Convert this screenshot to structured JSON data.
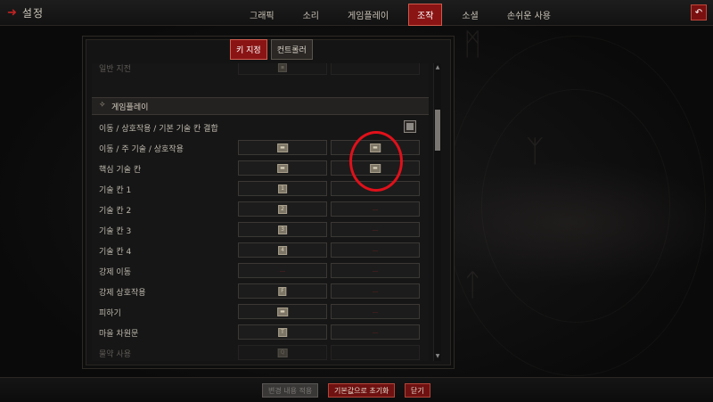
{
  "header": {
    "title": "설정",
    "tabs": [
      {
        "label": "그래픽",
        "active": false
      },
      {
        "label": "소리",
        "active": false
      },
      {
        "label": "게임플레이",
        "active": false
      },
      {
        "label": "조작",
        "active": true
      },
      {
        "label": "소셜",
        "active": false
      },
      {
        "label": "손쉬운 사용",
        "active": false
      }
    ],
    "exit_icon": "return-arrow-icon"
  },
  "subtabs": [
    {
      "label": "키 지정",
      "active": true
    },
    {
      "label": "컨트롤러",
      "active": false
    }
  ],
  "section": {
    "title": "게임플레이",
    "icon": "diamond-icon"
  },
  "rows": [
    {
      "label": "일반 지전",
      "key1": "▪",
      "key2": "",
      "faded": true
    },
    {
      "label": "이동 / 상호작용 / 기본 기술 칸 결합",
      "checkbox": true,
      "checked": true
    },
    {
      "label": "이동 / 주 기술 / 상호작용",
      "key1": "▬",
      "key2": "▬"
    },
    {
      "label": "핵심 기술 칸",
      "key1": "▬",
      "key2": "▬"
    },
    {
      "label": "기술 칸 1",
      "key1": "1",
      "key2": "—"
    },
    {
      "label": "기술 칸 2",
      "key1": "2",
      "key2": "—"
    },
    {
      "label": "기술 칸 3",
      "key1": "3",
      "key2": "—"
    },
    {
      "label": "기술 칸 4",
      "key1": "4",
      "key2": "—"
    },
    {
      "label": "강제 이동",
      "key1": "—",
      "key2": "—"
    },
    {
      "label": "강제 상호작용",
      "key1": "F",
      "key2": "—"
    },
    {
      "label": "피하기",
      "key1": "▬",
      "key2": "—"
    },
    {
      "label": "마을 차원문",
      "key1": "T",
      "key2": "—"
    },
    {
      "label": "물약 사용",
      "key1": "Q",
      "key2": "",
      "faded": true
    }
  ],
  "footer": {
    "buttons": [
      {
        "label": "변경 내용 적용",
        "disabled": true
      },
      {
        "label": "기본값으로 초기화",
        "disabled": false
      },
      {
        "label": "닫기",
        "disabled": false
      }
    ]
  },
  "colors": {
    "accent_red": "#8a1414",
    "highlight_ring": "#e0101a",
    "background": "#0b0b0b"
  }
}
